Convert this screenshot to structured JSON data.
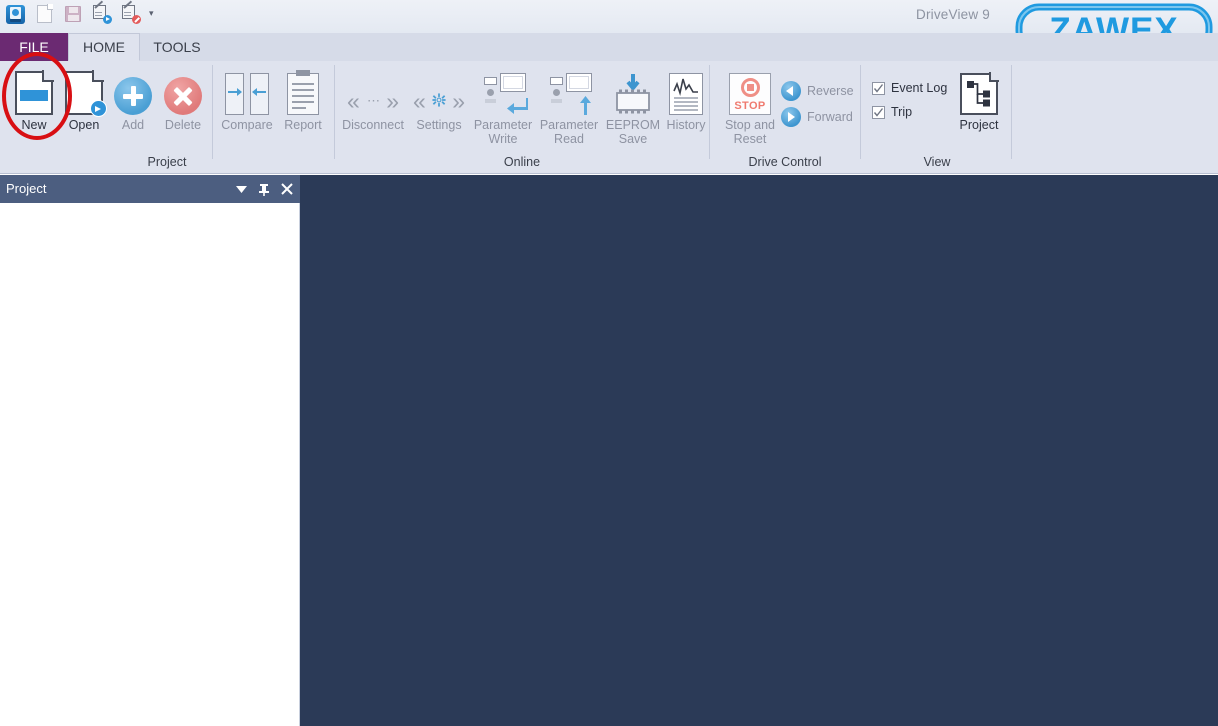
{
  "window": {
    "app_title": "DriveView 9",
    "logo_text": "ZAWEX",
    "logo_color": "#1f9ae0"
  },
  "quick_access": {
    "items": [
      {
        "name": "app-icon",
        "label": "DriveView"
      },
      {
        "name": "new-icon",
        "label": "New"
      },
      {
        "name": "save-icon",
        "label": "Save"
      },
      {
        "name": "edit-connect-icon",
        "label": "Connect"
      },
      {
        "name": "edit-disconnect-icon",
        "label": "Disconnect"
      },
      {
        "name": "chevron-down-icon",
        "label": "Customize Quick Access Toolbar"
      }
    ],
    "caret": "▾"
  },
  "tabs": [
    {
      "id": "file",
      "label": "FILE",
      "active": false
    },
    {
      "id": "home",
      "label": "HOME",
      "active": true
    },
    {
      "id": "tools",
      "label": "TOOLS",
      "active": false
    }
  ],
  "ribbon": {
    "groups": [
      {
        "id": "project",
        "label": "Project",
        "buttons": [
          {
            "id": "new",
            "label": "New",
            "enabled": true
          },
          {
            "id": "open",
            "label": "Open",
            "enabled": true
          },
          {
            "id": "add",
            "label": "Add",
            "enabled": false
          },
          {
            "id": "delete",
            "label": "Delete",
            "enabled": false
          },
          {
            "id": "compare",
            "label": "Compare",
            "enabled": false
          },
          {
            "id": "report",
            "label": "Report",
            "enabled": false
          }
        ]
      },
      {
        "id": "online",
        "label": "Online",
        "buttons": [
          {
            "id": "disconnect",
            "label": "Disconnect",
            "enabled": false
          },
          {
            "id": "settings",
            "label": "Settings",
            "enabled": false
          },
          {
            "id": "parameter-write",
            "label": "Parameter\nWrite",
            "line1": "Parameter",
            "line2": "Write",
            "enabled": false
          },
          {
            "id": "parameter-read",
            "label": "Parameter\nRead",
            "line1": "Parameter",
            "line2": "Read",
            "enabled": false
          },
          {
            "id": "eeprom-save",
            "label": "EEPROM\nSave",
            "line1": "EEPROM",
            "line2": "Save",
            "enabled": false
          },
          {
            "id": "history",
            "label": "History",
            "enabled": false
          }
        ]
      },
      {
        "id": "drive-control",
        "label": "Drive Control",
        "buttons": [
          {
            "id": "stop-and-reset",
            "label": "Stop and\nReset",
            "line1": "Stop and",
            "line2": "Reset",
            "badge": "STOP",
            "enabled": false
          },
          {
            "id": "reverse",
            "label": "Reverse",
            "enabled": false
          },
          {
            "id": "forward",
            "label": "Forward",
            "enabled": false
          }
        ]
      },
      {
        "id": "view",
        "label": "View",
        "checkboxes": [
          {
            "id": "event-log",
            "label": "Event Log",
            "checked": true
          },
          {
            "id": "trip",
            "label": "Trip",
            "checked": true
          }
        ],
        "buttons": [
          {
            "id": "project-view",
            "label": "Project",
            "enabled": true
          }
        ]
      }
    ]
  },
  "dock_panel": {
    "title": "Project",
    "controls": [
      {
        "name": "panel-menu-button",
        "glyph": "▼"
      },
      {
        "name": "panel-pin-button",
        "glyph": "⊥"
      },
      {
        "name": "panel-close-button",
        "glyph": "✕"
      }
    ]
  },
  "workspace": {
    "background": "#2b3a57",
    "content": ""
  },
  "annotation": {
    "shape": "ellipse",
    "color": "#d80f13",
    "target": "New"
  }
}
